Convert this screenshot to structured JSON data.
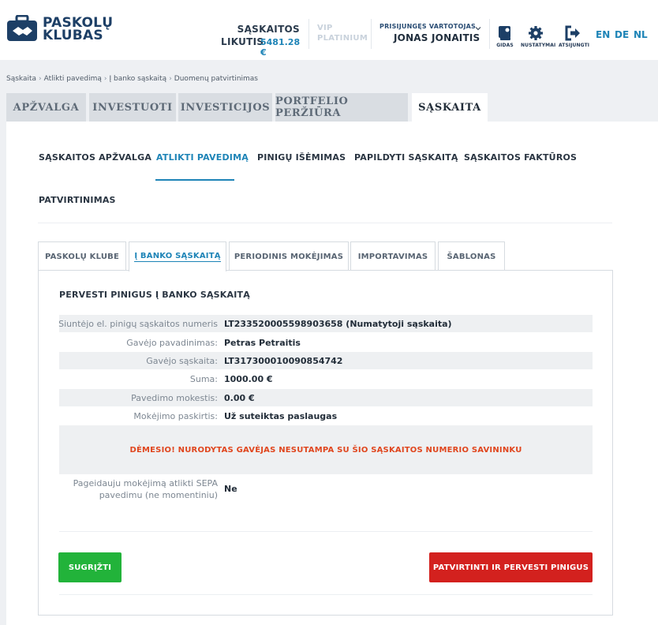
{
  "brand": {
    "line1": "PASKOLŲ",
    "line2": "KLUBAS",
    "color": "#1d3f66"
  },
  "header": {
    "balance_label_top": "SĄSKAITOS",
    "balance_label_bottom": "LIKUTIS",
    "balance_amount": "5481.28 €",
    "vip_line1": "VIP",
    "vip_line2": "PLATINIUM",
    "user_caption": "PRISIJUNGĘS VARTOTOJAS",
    "user_name": "JONAS JONAITIS",
    "tools": [
      {
        "label": "GIDAS",
        "icon": "guide-icon"
      },
      {
        "label": "NUSTATYMAI",
        "icon": "gear-icon"
      },
      {
        "label": "ATSIJUNGTI",
        "icon": "logout-icon"
      }
    ],
    "languages": [
      "EN",
      "DE",
      "NL"
    ]
  },
  "breadcrumb": [
    "Sąskaita",
    "Atlikti pavedimą",
    "Į banko sąskaitą",
    "Duomenų patvirtinimas"
  ],
  "main_tabs": [
    {
      "label": "APŽVALGA"
    },
    {
      "label": "INVESTUOTI"
    },
    {
      "label": "INVESTICIJOS"
    },
    {
      "label": "PORTFELIO PERŽIŪRA"
    },
    {
      "label": "SĄSKAITA"
    }
  ],
  "sub_nav": [
    {
      "label": "SĄSKAITOS APŽVALGA"
    },
    {
      "label": "ATLIKTI PAVEDIMĄ"
    },
    {
      "label": "PINIGŲ IŠĖMIMAS"
    },
    {
      "label": "PAPILDYTI SĄSKAITĄ"
    },
    {
      "label": "SĄSKAITOS FAKTŪROS"
    },
    {
      "label": "PATVIRTINIMAS"
    }
  ],
  "inner_tabs": [
    {
      "label": "PASKOLŲ KLUBE"
    },
    {
      "label": "Į BANKO SĄSKAITĄ"
    },
    {
      "label": "PERIODINIS MOKĖJIMAS"
    },
    {
      "label": "IMPORTAVIMAS"
    },
    {
      "label": "ŠABLONAS"
    }
  ],
  "form": {
    "title": "PERVESTI PINIGUS Į BANKO SĄSKAITĄ",
    "rows": [
      {
        "label": "Siuntėjo el. pinigų sąskaitos numeris",
        "value": "LT233520005598903658 (Numatytoji sąskaita)"
      },
      {
        "label": "Gavėjo pavadinimas:",
        "value": "Petras Petraitis"
      },
      {
        "label": "Gavėjo sąskaita:",
        "value": "LT317300010090854742"
      },
      {
        "label": "Suma:",
        "value": "1000.00 €"
      },
      {
        "label": "Pavedimo mokestis:",
        "value": "0.00 €"
      },
      {
        "label": "Mokėjimo paskirtis:",
        "value": "Už suteiktas paslaugas"
      }
    ],
    "warning": "DĖMESIO! NURODYTAS GAVĖJAS NESUTAMPA SU ŠIO SĄSKAITOS NUMERIO SAVININKU",
    "sepa_label": "Pageidauju mokėjimą atlikti SEPA pavedimu (ne momentiniu)",
    "sepa_value": "Ne",
    "back_button": "SUGRĮŽTI",
    "confirm_button": "PATVIRTINTI IR PERVESTI PINIGUS"
  },
  "colors": {
    "accent": "#1e84b7",
    "back_button": "#22b33a",
    "confirm_button": "#d3211e",
    "warning_text": "#e0461e",
    "background_band": "#eef0f3"
  }
}
